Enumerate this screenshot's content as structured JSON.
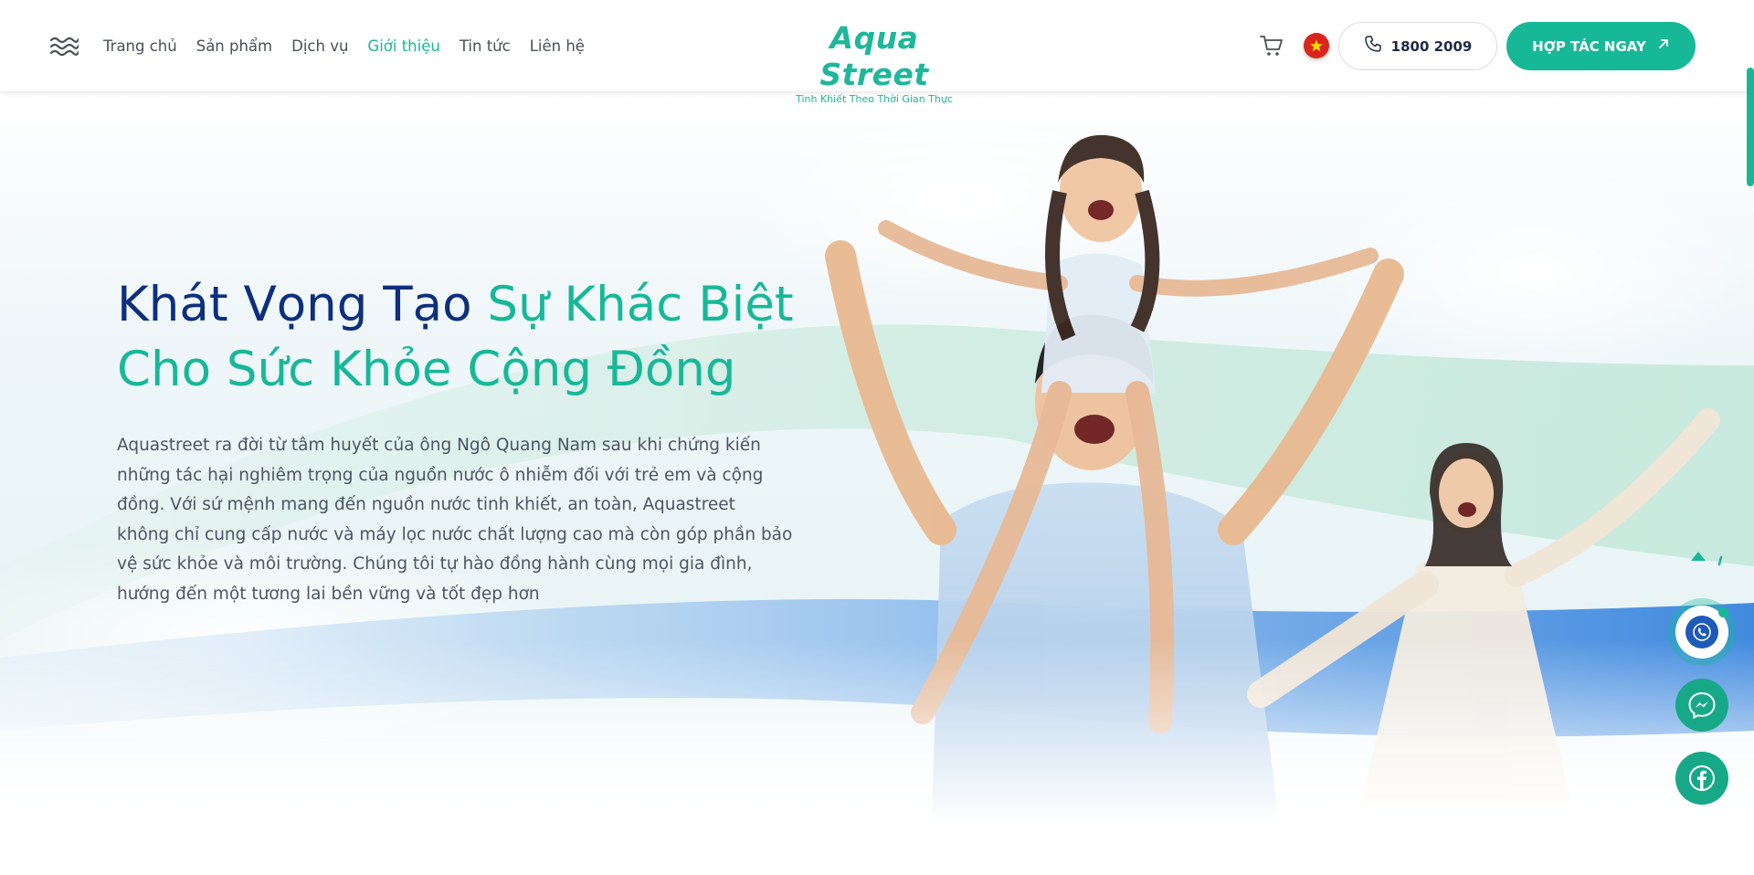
{
  "header": {
    "nav": [
      {
        "label": "Trang chủ",
        "active": false
      },
      {
        "label": "Sản phẩm",
        "active": false
      },
      {
        "label": "Dịch vụ",
        "active": false
      },
      {
        "label": "Giới thiệu",
        "active": true
      },
      {
        "label": "Tin tức",
        "active": false
      },
      {
        "label": "Liên hệ",
        "active": false
      }
    ],
    "logo": {
      "text": "Aqua Street",
      "tagline": "Tinh Khiết Theo Thời Gian Thực"
    },
    "phone_label": "1800 2009",
    "cta_label": "HỢP TÁC NGAY"
  },
  "hero": {
    "title_dark": "Khát Vọng Tạo ",
    "title_green_1": "Sự Khác Biệt",
    "title_green_2": "Cho Sức Khỏe Cộng Đồng",
    "description": "Aquastreet ra đời từ tâm huyết của ông Ngô Quang Nam sau khi chứng kiến những tác hại nghiêm trọng của nguồn nước ô nhiễm đối với trẻ em và cộng đồng. Với sứ mệnh mang đến nguồn nước tinh khiết, an toàn, Aquastreet không chỉ cung cấp nước và máy lọc nước chất lượng cao mà còn góp phần bảo vệ sức khỏe và môi trường. Chúng tôi tự hào đồng hành cùng mọi gia đình, hướng đến một tương lai bền vững và tốt đẹp hơn"
  },
  "colors": {
    "brand_green": "#17b897",
    "title_navy": "#0e2f7e",
    "flag_red": "#da251d",
    "wave_blue": "#2f7fdc"
  },
  "icons": {
    "menu": "wave-menu-icon",
    "cart": "cart-icon",
    "flag": "vietnam-flag-icon",
    "phone": "phone-icon",
    "cta": "arrow-up-right-icon",
    "back_to_top": "arrow-up-icon",
    "float_phone": "whatsapp-icon",
    "float_messenger": "messenger-icon",
    "float_facebook": "facebook-icon"
  }
}
